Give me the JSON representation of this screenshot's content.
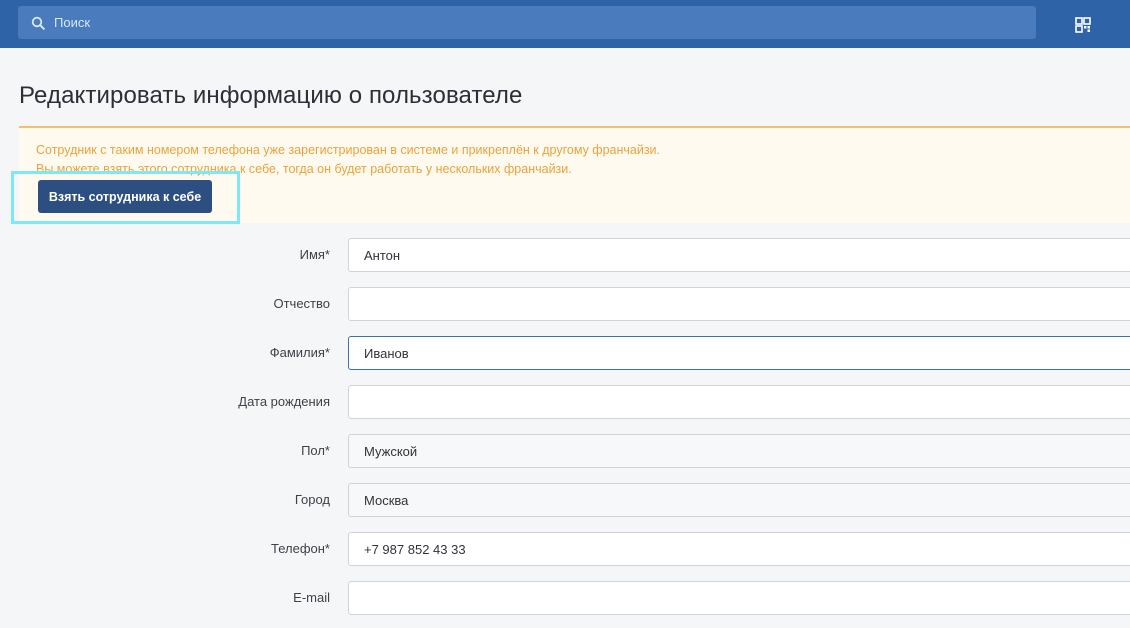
{
  "header": {
    "search_placeholder": "Поиск",
    "qr_icon": "qr-code-icon",
    "bg_color": "#2e63a8"
  },
  "page": {
    "title": "Редактировать информацию о пользователе"
  },
  "alert": {
    "line1": "Сотрудник с таким номером телефона уже зарегистрирован в системе и прикреплён к другому франчайзи.",
    "line2": "Вы можете взять этого сотрудника к себе, тогда он будет работать у нескольких франчайзи.",
    "button_label": "Взять сотрудника к себе",
    "text_color": "#e8a33b"
  },
  "form": {
    "fields": [
      {
        "label": "Имя*",
        "value": "Антон"
      },
      {
        "label": "Отчество",
        "value": ""
      },
      {
        "label": "Фамилия*",
        "value": "Иванов"
      },
      {
        "label": "Дата рождения",
        "value": ""
      },
      {
        "label": "Пол*",
        "value": "Мужской"
      },
      {
        "label": "Город",
        "value": "Москва"
      },
      {
        "label": "Телефон*",
        "value": "+7 987 852 43 33"
      },
      {
        "label": "E-mail",
        "value": ""
      }
    ]
  }
}
